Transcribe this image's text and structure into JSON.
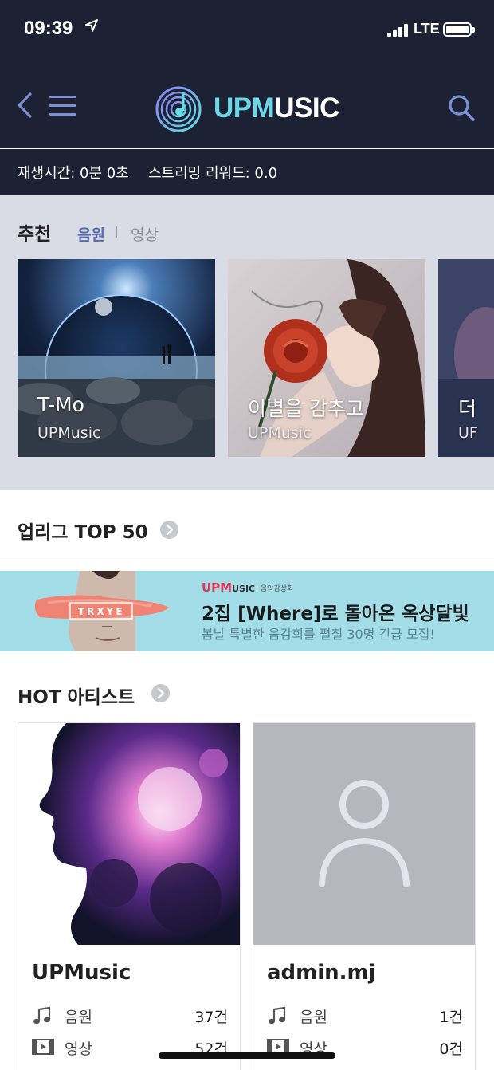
{
  "status_bar": {
    "time": "09:39",
    "location_icon": "location-arrow-icon",
    "network": "LTE",
    "battery_level": 1.0
  },
  "header": {
    "logo": {
      "part_a": "UPM",
      "part_b": "USIC"
    },
    "icons": [
      "back-arrow-icon",
      "hamburger-menu-icon",
      "search-icon"
    ],
    "accent_color": "#6ad6e8",
    "bg_color": "#1c2133"
  },
  "playbar": {
    "play_time": "재생시간: 0분 0초",
    "reward": "스트리밍 리워드: 0.0"
  },
  "recommend": {
    "title": "추천",
    "tabs": [
      "음원",
      "영상"
    ],
    "active_tab": "음원",
    "cards": [
      {
        "title": "T-Mo",
        "subtitle": "UPMusic"
      },
      {
        "title": "이별을 감추고",
        "subtitle": "UPMusic"
      },
      {
        "title": "더",
        "subtitle": "UF"
      }
    ]
  },
  "top50": {
    "label": "업리그 TOP 50"
  },
  "banner": {
    "brand_a": "UPM",
    "brand_b": "USIC",
    "tag": "음악감상회",
    "art_text": "TRXYE",
    "headline": "2집 [Where]로 돌아온 옥상달빛",
    "description": "봄날 특별한 음감회를 펼칠 30명 긴급 모집!"
  },
  "hot_artists": {
    "title": "HOT 아티스트",
    "artists": [
      {
        "name": "UPMusic",
        "stats": [
          {
            "label": "음원",
            "value": "37건"
          },
          {
            "label": "영상",
            "value": "52건"
          }
        ]
      },
      {
        "name": "admin.mj",
        "stats": [
          {
            "label": "음원",
            "value": "1건"
          },
          {
            "label": "영상",
            "value": "0건"
          }
        ]
      }
    ]
  }
}
